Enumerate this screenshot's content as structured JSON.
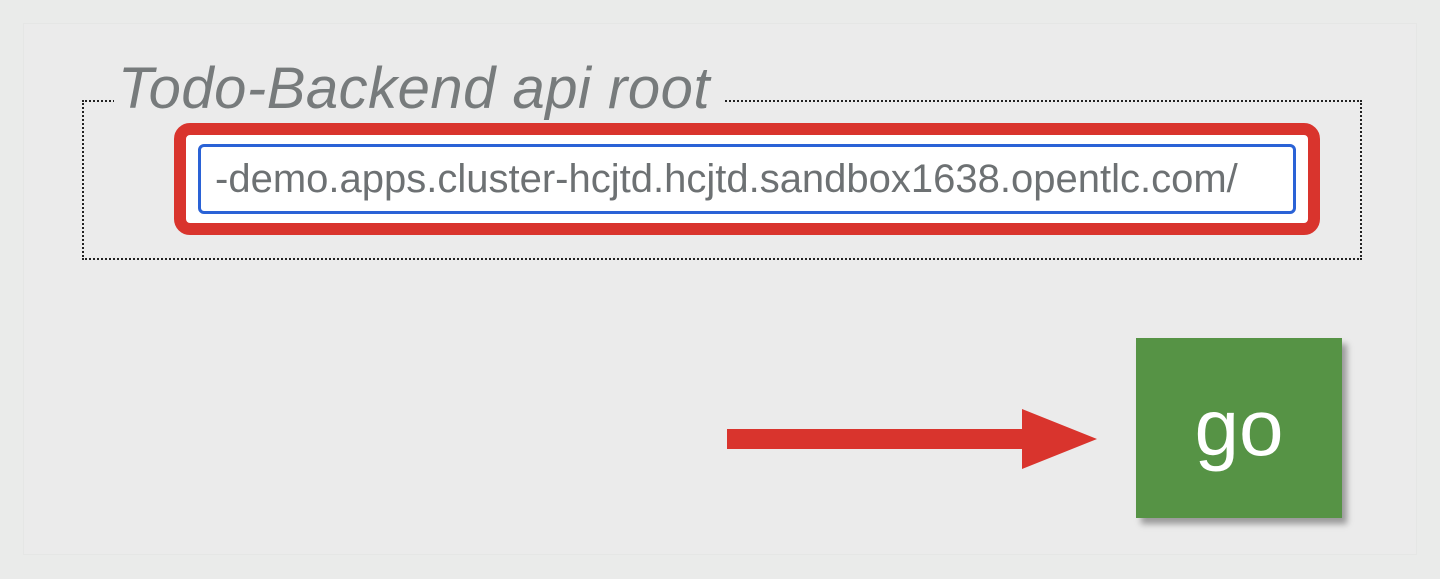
{
  "legend": "Todo-Backend api root",
  "input": {
    "value": "-demo.apps.cluster-hcjtd.hcjtd.sandbox1638.opentlc.com/"
  },
  "goButton": {
    "label": "go"
  },
  "colors": {
    "highlight": "#d9342d",
    "inputFocus": "#2a62d6",
    "go": "#569345",
    "pageBg": "#ebebeb"
  }
}
